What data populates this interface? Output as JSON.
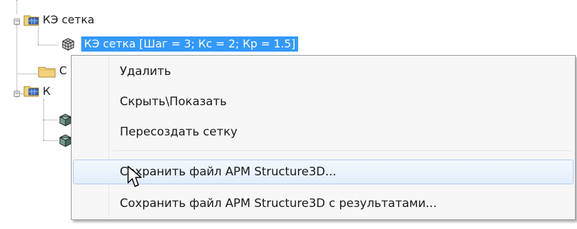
{
  "tree": {
    "nodes": [
      {
        "label": "КЭ сетка",
        "icon": "folder-grid-icon",
        "expander": "−"
      },
      {
        "label": "КЭ сетка [Шаг = 3; Кс = 2; Кр = 1.5]",
        "icon": "mesh-cube-icon",
        "selected": true
      },
      {
        "label": "С",
        "icon": "folder-icon"
      },
      {
        "label": "К",
        "icon": "folder-grid-icon",
        "expander": "−"
      },
      {
        "label": "",
        "icon": "solid-cube-icon"
      },
      {
        "label": "",
        "icon": "solid-cube-icon"
      }
    ]
  },
  "context_menu": {
    "items": [
      {
        "label": "Удалить"
      },
      {
        "label": "Скрыть\\Показать"
      },
      {
        "label": "Пересоздать сетку"
      },
      {
        "label": "Сохранить файл APM Structure3D...",
        "hovered": true
      },
      {
        "label": "Сохранить файл APM Structure3D с результатами..."
      }
    ]
  },
  "colors": {
    "selection": "#3399ff",
    "menu_background": "#f7f7f7",
    "hover_border": "#aeccf0"
  },
  "cursor": {
    "icon": "arrow-pointer-icon"
  }
}
